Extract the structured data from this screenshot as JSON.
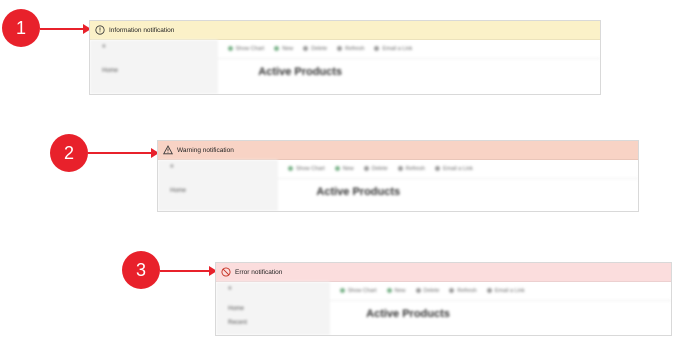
{
  "callouts": [
    "1",
    "2",
    "3"
  ],
  "notifications": [
    {
      "type": "information",
      "text": "Information notification",
      "icon": "info-circle-icon",
      "color": "#fbf1c8"
    },
    {
      "type": "warning",
      "text": "Warning notification",
      "icon": "warning-triangle-icon",
      "color": "#f8d3c5"
    },
    {
      "type": "error",
      "text": "Error notification",
      "icon": "blocked-circle-icon",
      "color": "#fbdddd"
    }
  ],
  "app": {
    "sidebar_item": "Home",
    "sidebar_item2": "Recent",
    "commands": [
      "Show Chart",
      "New",
      "Delete",
      "Refresh",
      "Email a Link"
    ],
    "page_title": "Active Products"
  }
}
